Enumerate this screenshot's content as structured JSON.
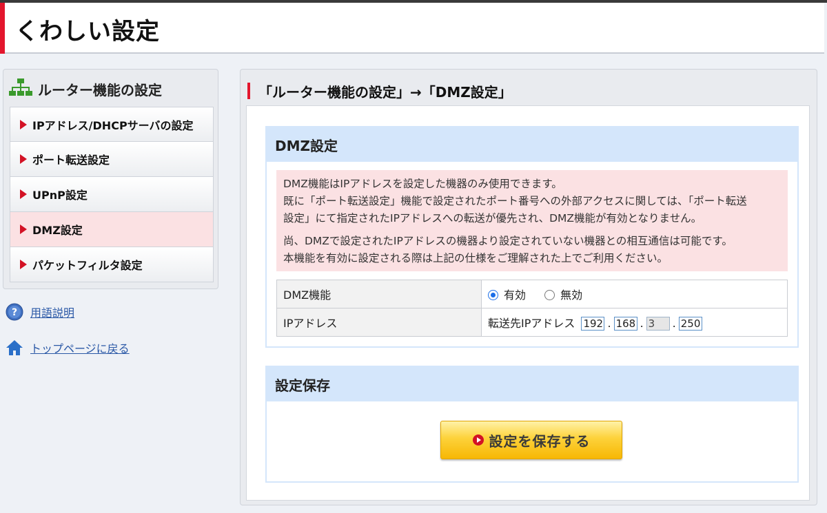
{
  "header": {
    "title": "くわしい設定"
  },
  "sidebar": {
    "title": "ルーター機能の設定",
    "items": [
      {
        "label": "IPアドレス/DHCPサーバの設定",
        "active": false
      },
      {
        "label": "ポート転送設定",
        "active": false
      },
      {
        "label": "UPnP設定",
        "active": false
      },
      {
        "label": "DMZ設定",
        "active": true
      },
      {
        "label": "パケットフィルタ設定",
        "active": false
      }
    ],
    "links": [
      {
        "label": "用語説明",
        "icon": "help-icon"
      },
      {
        "label": "トップページに戻る",
        "icon": "home-icon"
      }
    ]
  },
  "main": {
    "title": "「ルーター機能の設定」→「DMZ設定」",
    "dmz": {
      "heading": "DMZ設定",
      "notice_lines_1": [
        "DMZ機能はIPアドレスを設定した機器のみ使用できます。",
        "既に「ポート転送設定」機能で設定されたポート番号への外部アクセスに関しては、「ポート転送",
        "設定」にて指定されたIPアドレスへの転送が優先され、DMZ機能が有効となりません。"
      ],
      "notice_lines_2": [
        "尚、DMZで設定されたIPアドレスの機器より設定されていない機器との相互通信は可能です。",
        "本機能を有効に設定される際は上記の仕様をご理解された上でご利用ください。"
      ],
      "rows": {
        "function_label": "DMZ機能",
        "enable_label": "有効",
        "disable_label": "無効",
        "selected": "有効",
        "ip_label": "IPアドレス",
        "ip_prefix": "転送先IPアドレス",
        "ip_octets": [
          "192",
          "168",
          "3",
          "250"
        ]
      }
    },
    "save": {
      "heading": "設定保存",
      "button_label": "設定を保存する"
    }
  },
  "colors": {
    "accent_red": "#e3162d",
    "section_blue": "#d4e6fb",
    "notice_pink": "#fbe1e3",
    "button_yellow": "#fdd23a",
    "link_blue": "#2a58a6"
  }
}
